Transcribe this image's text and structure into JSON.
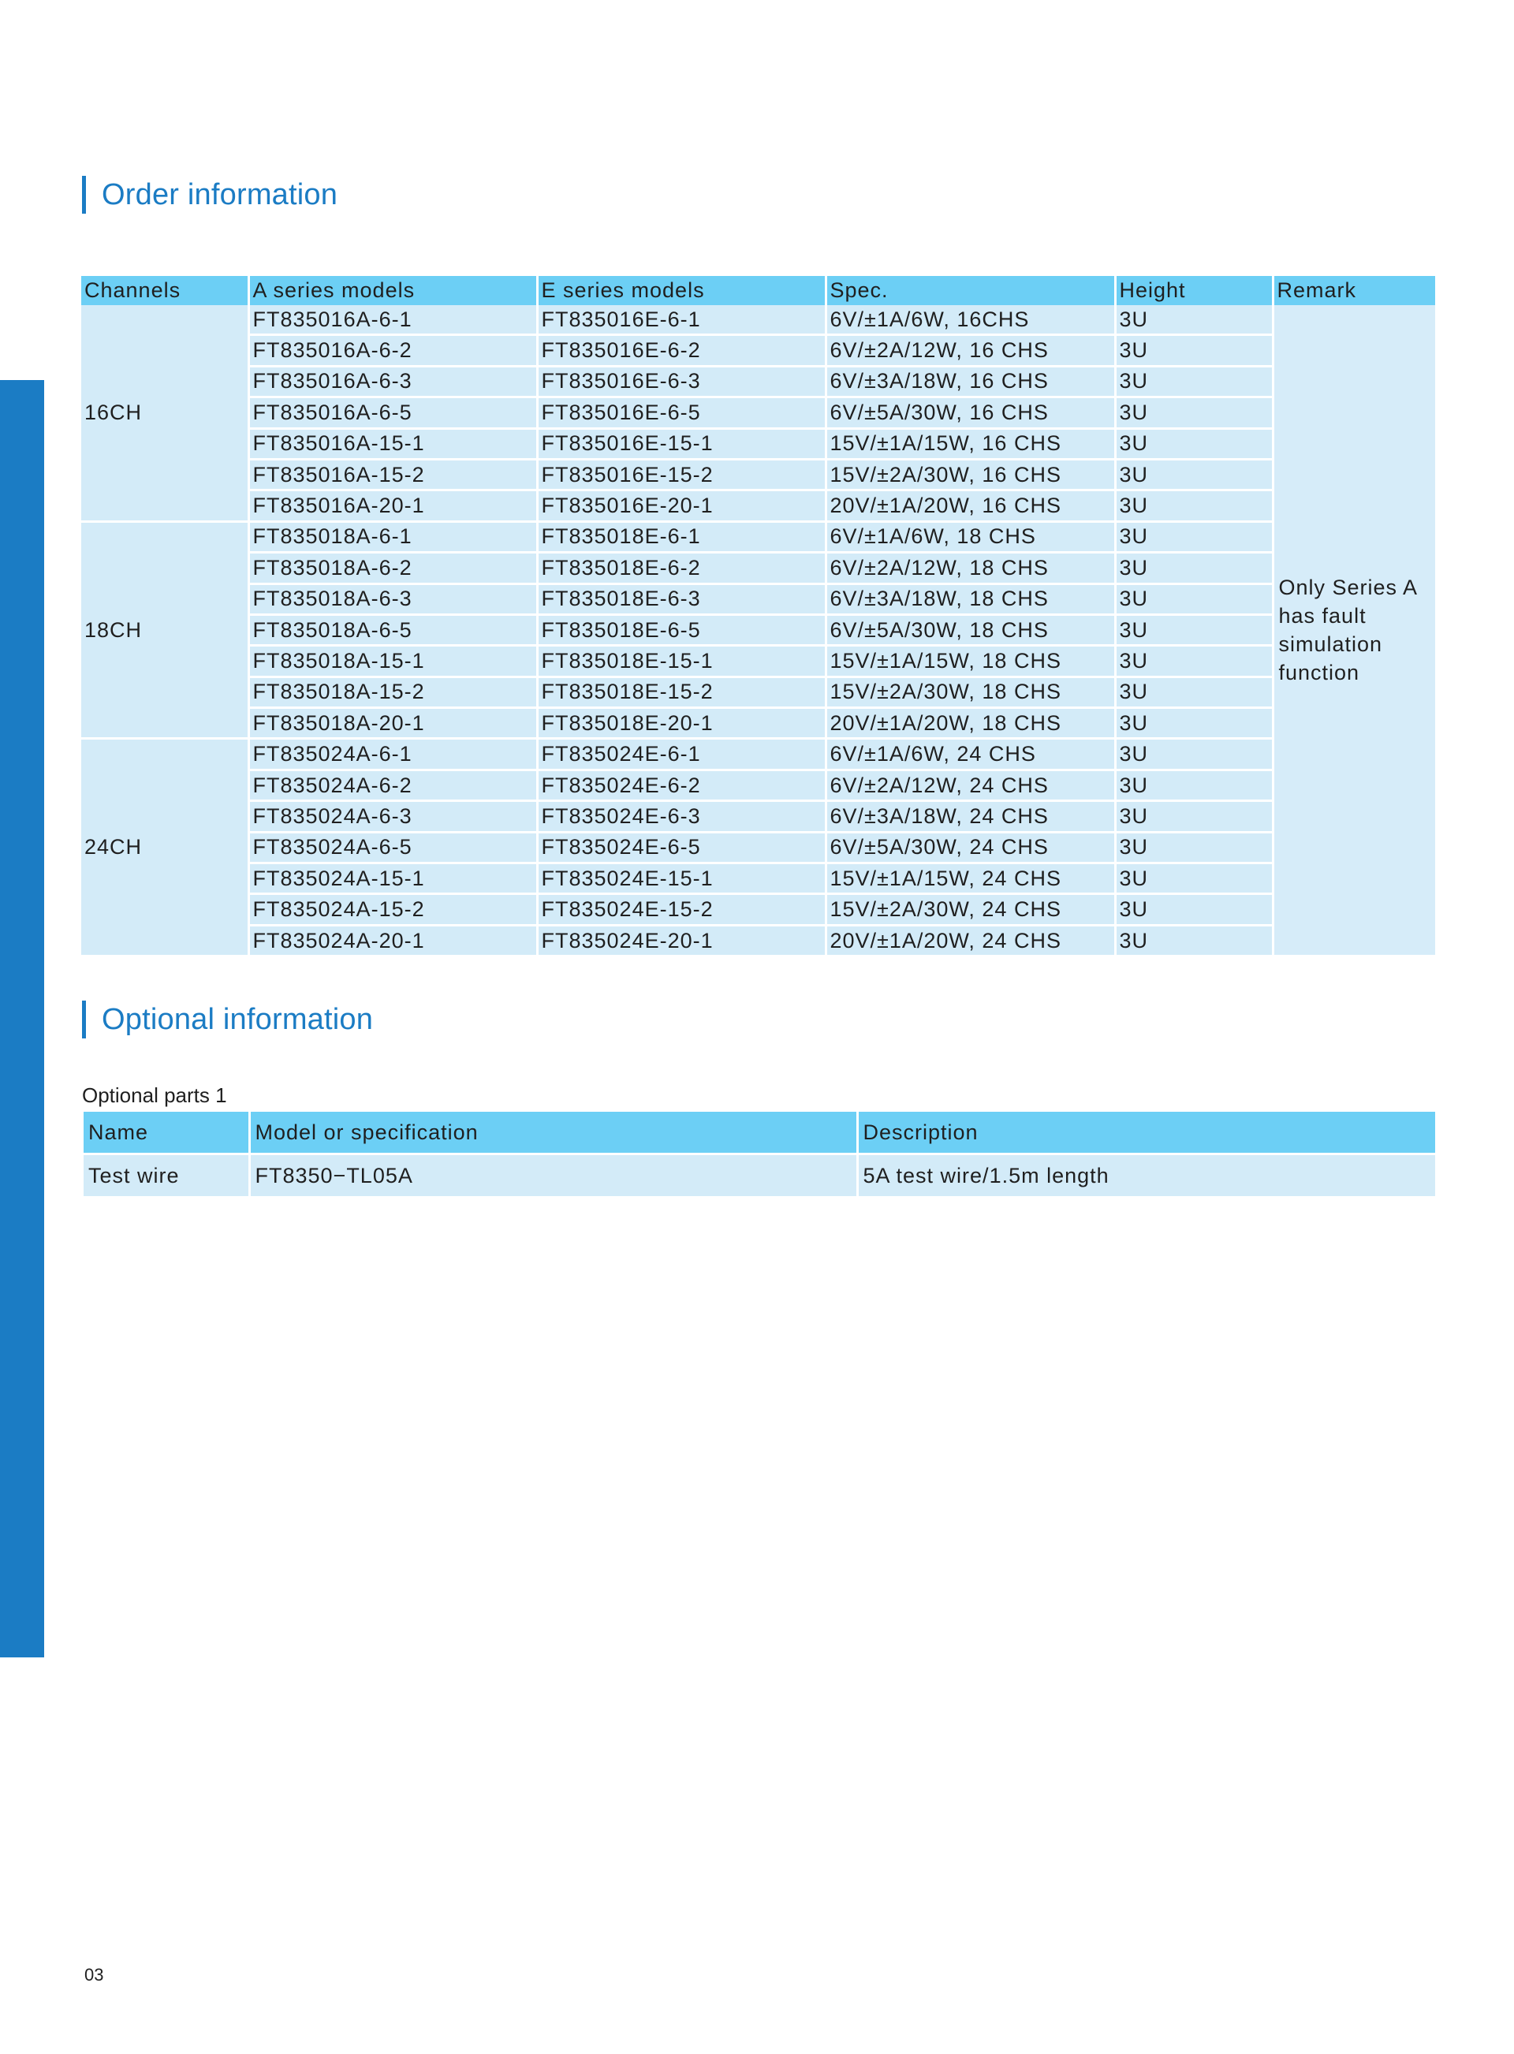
{
  "colors": {
    "accent": "#1b7cc4",
    "header_fill": "#6ccff5",
    "row_fill": "#d3ebf8"
  },
  "order": {
    "title": "Order information",
    "headers": [
      "Channels",
      "A series models",
      "E series models",
      "Spec.",
      "Height",
      "Remark"
    ],
    "remark": "Only Series A has fault simulation function",
    "groups": [
      {
        "channels": "16CH",
        "rows": [
          [
            "FT835016A-6-1",
            "FT835016E-6-1",
            "6V/±1A/6W, 16CHS",
            "3U"
          ],
          [
            "FT835016A-6-2",
            "FT835016E-6-2",
            "6V/±2A/12W, 16 CHS",
            "3U"
          ],
          [
            "FT835016A-6-3",
            "FT835016E-6-3",
            "6V/±3A/18W, 16 CHS",
            "3U"
          ],
          [
            "FT835016A-6-5",
            "FT835016E-6-5",
            "6V/±5A/30W, 16 CHS",
            "3U"
          ],
          [
            "FT835016A-15-1",
            "FT835016E-15-1",
            "15V/±1A/15W, 16 CHS",
            "3U"
          ],
          [
            "FT835016A-15-2",
            "FT835016E-15-2",
            "15V/±2A/30W, 16 CHS",
            "3U"
          ],
          [
            "FT835016A-20-1",
            "FT835016E-20-1",
            "20V/±1A/20W, 16 CHS",
            "3U"
          ]
        ]
      },
      {
        "channels": "18CH",
        "rows": [
          [
            "FT835018A-6-1",
            "FT835018E-6-1",
            "6V/±1A/6W, 18 CHS",
            "3U"
          ],
          [
            "FT835018A-6-2",
            "FT835018E-6-2",
            "6V/±2A/12W, 18 CHS",
            "3U"
          ],
          [
            "FT835018A-6-3",
            "FT835018E-6-3",
            "6V/±3A/18W, 18 CHS",
            "3U"
          ],
          [
            "FT835018A-6-5",
            "FT835018E-6-5",
            "6V/±5A/30W, 18 CHS",
            "3U"
          ],
          [
            "FT835018A-15-1",
            "FT835018E-15-1",
            "15V/±1A/15W, 18 CHS",
            "3U"
          ],
          [
            "FT835018A-15-2",
            "FT835018E-15-2",
            "15V/±2A/30W, 18 CHS",
            "3U"
          ],
          [
            "FT835018A-20-1",
            "FT835018E-20-1",
            "20V/±1A/20W, 18 CHS",
            "3U"
          ]
        ]
      },
      {
        "channels": "24CH",
        "rows": [
          [
            "FT835024A-6-1",
            "FT835024E-6-1",
            "6V/±1A/6W, 24 CHS",
            "3U"
          ],
          [
            "FT835024A-6-2",
            "FT835024E-6-2",
            "6V/±2A/12W, 24 CHS",
            "3U"
          ],
          [
            "FT835024A-6-3",
            "FT835024E-6-3",
            "6V/±3A/18W, 24 CHS",
            "3U"
          ],
          [
            "FT835024A-6-5",
            "FT835024E-6-5",
            "6V/±5A/30W, 24 CHS",
            "3U"
          ],
          [
            "FT835024A-15-1",
            "FT835024E-15-1",
            "15V/±1A/15W, 24 CHS",
            "3U"
          ],
          [
            "FT835024A-15-2",
            "FT835024E-15-2",
            "15V/±2A/30W, 24 CHS",
            "3U"
          ],
          [
            "FT835024A-20-1",
            "FT835024E-20-1",
            "20V/±1A/20W, 24 CHS",
            "3U"
          ]
        ]
      }
    ]
  },
  "optional": {
    "title": "Optional information",
    "caption": "Optional parts 1",
    "headers": [
      "Name",
      "Model or specification",
      "Description"
    ],
    "rows": [
      [
        "Test wire",
        "FT8350−TL05A",
        "5A test wire/1.5m length"
      ]
    ]
  },
  "page_number": "03"
}
